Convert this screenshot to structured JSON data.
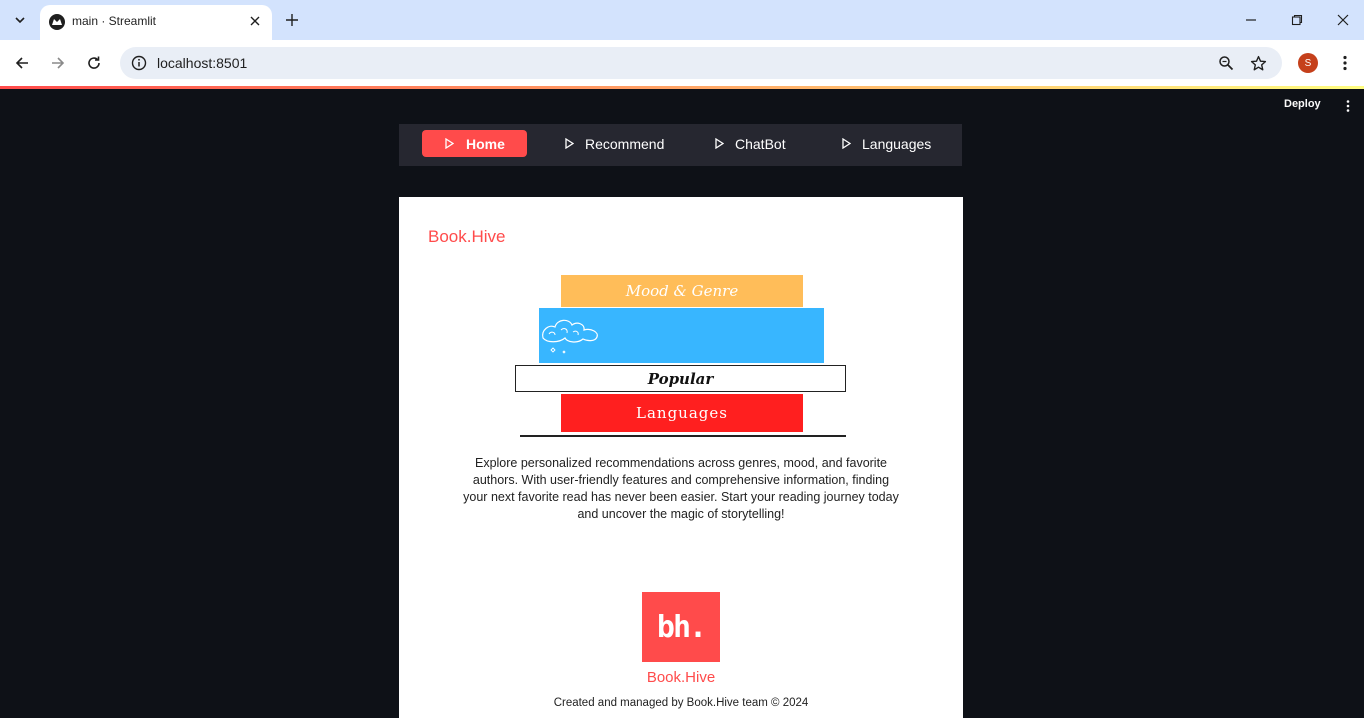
{
  "browser": {
    "tab_title": "main · Streamlit",
    "url": "localhost:8501",
    "profile_initial": "S"
  },
  "app": {
    "deploy_label": "Deploy",
    "nav": {
      "items": [
        {
          "label": "Home",
          "active": true
        },
        {
          "label": "Recommend",
          "active": false
        },
        {
          "label": "ChatBot",
          "active": false
        },
        {
          "label": "Languages",
          "active": false
        }
      ],
      "accent_color": "#ff4b4b",
      "background": "#262730"
    },
    "brand": "Book.Hive",
    "books": {
      "mood": "Mood & Genre",
      "popular": "Popular",
      "languages": "Languages"
    },
    "description": "Explore personalized recommendations across genres, mood, and favorite authors. With user-friendly features and comprehensive information, finding your next favorite read has never been easier. Start your reading journey today and uncover the magic of storytelling!",
    "logo_text": "bh.",
    "footer_brand": "Book.Hive",
    "footer": "Created and managed by Book.Hive team © 2024"
  }
}
